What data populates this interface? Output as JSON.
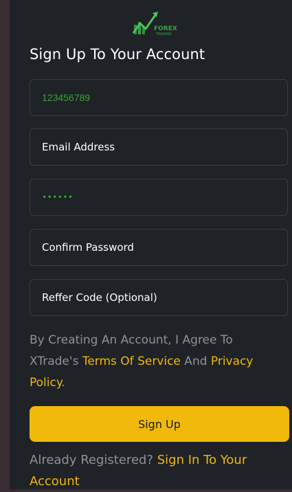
{
  "logo": {
    "word_top": "FOREX",
    "word_bottom": "TRADING",
    "accent": "#3aa04a"
  },
  "title": "Sign Up To Your Account",
  "form": {
    "phone_value": "123456789",
    "email_placeholder": "Email Address",
    "password_masked": "••••••",
    "confirm_placeholder": "Confirm Password",
    "referral_placeholder": "Reffer Code (Optional)"
  },
  "agreement": {
    "prefix": "By Creating An Account, I Agree To XTrade's ",
    "terms_link": "Terms Of Service",
    "and": " And ",
    "privacy_link": "Privacy Policy",
    "suffix": "."
  },
  "signup_button": "Sign Up",
  "signin": {
    "prefix": "Already Registered? ",
    "link": "Sign In To Your Account"
  },
  "colors": {
    "accent": "#f0b90b",
    "panel_bg": "#1f2227",
    "outer_bg": "#3a2c33",
    "muted_text": "#8e929a",
    "input_text": "#2ea82e"
  }
}
